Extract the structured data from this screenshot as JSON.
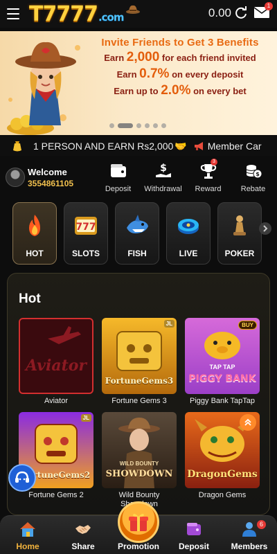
{
  "header": {
    "logo_main": "T7777",
    "logo_suffix": ".com",
    "balance": "0.00",
    "mail_badge": "1"
  },
  "banner": {
    "title": "Invite Friends to Get 3 Benefits",
    "line1_pre": "Earn ",
    "line1_value": "2,000",
    "line1_post": " for each friend invited",
    "line2_pre": "Earn ",
    "line2_value": "0.7%",
    "line2_post": " on every deposit",
    "line3_pre": "Earn up to ",
    "line3_value": "2.0%",
    "line3_post": " on every bet",
    "slides_total": 6,
    "slide_active": 2
  },
  "marquee": {
    "text": "1 PERSON AND EARN Rs2,000",
    "text2": "Member Car"
  },
  "user": {
    "welcome": "Welcome",
    "id": "3554861105"
  },
  "quick_actions": [
    {
      "label": "Deposit",
      "icon": "wallet-icon"
    },
    {
      "label": "Withdrawal",
      "icon": "cash-hand-icon"
    },
    {
      "label": "Reward",
      "icon": "trophy-icon",
      "badge": "3"
    },
    {
      "label": "Rebate",
      "icon": "coins-icon"
    }
  ],
  "categories": [
    {
      "label": "HOT",
      "icon": "flame-icon",
      "active": true
    },
    {
      "label": "SLOTS",
      "icon": "slot-777-icon"
    },
    {
      "label": "FISH",
      "icon": "shark-icon"
    },
    {
      "label": "LIVE",
      "icon": "poker-chip-icon"
    },
    {
      "label": "POKER",
      "icon": "chess-pawn-icon"
    }
  ],
  "hot": {
    "title": "Hot",
    "games": [
      {
        "name": "Aviator",
        "art_text": "Aviator"
      },
      {
        "name": "Fortune Gems 3",
        "art_text": "FortuneGems3",
        "tag": "JL"
      },
      {
        "name": "Piggy Bank TapTap",
        "art_text": "PIGGY BANK",
        "art_text2": "TAP TAP",
        "tag": "BUY"
      },
      {
        "name": "Fortune Gems 2",
        "art_text": "FortuneGems2",
        "tag": "JL"
      },
      {
        "name": "Wild Bounty Showdown",
        "art_text": "SHOWDOWN",
        "art_text2": "WILD BOUNTY"
      },
      {
        "name": "Dragon Gems",
        "art_text": "DragonGems"
      }
    ]
  },
  "bottom_nav": [
    {
      "label": "Home",
      "icon": "house-icon",
      "active": true
    },
    {
      "label": "Share",
      "icon": "handshake-icon"
    },
    {
      "label": "Promotion",
      "icon": "gift-icon"
    },
    {
      "label": "Deposit",
      "icon": "wallet-card-icon"
    },
    {
      "label": "Members",
      "icon": "members-icon",
      "badge": "6"
    }
  ],
  "colors": {
    "accent_gold": "#f2b33d",
    "badge_red": "#e53935",
    "banner_orange": "#e86a12"
  }
}
